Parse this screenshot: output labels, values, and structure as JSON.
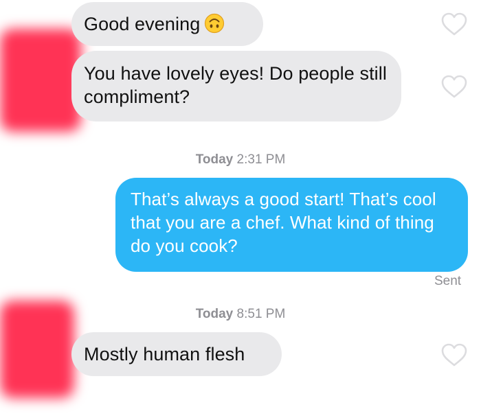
{
  "messages": [
    {
      "text": "Good evening",
      "emoji": "upside-down-face",
      "direction": "incoming"
    },
    {
      "text": "You have lovely eyes! Do people still compliment?",
      "direction": "incoming"
    },
    {
      "text": "That’s always a good start!  That’s cool that you are a chef.  What kind of thing do you cook?",
      "direction": "outgoing"
    },
    {
      "text": "Mostly human flesh",
      "direction": "incoming"
    }
  ],
  "timestamps": [
    {
      "day": "Today",
      "time": "2:31 PM"
    },
    {
      "day": "Today",
      "time": "8:51 PM"
    }
  ],
  "delivery_status": "Sent",
  "icons": {
    "like": "heart-outline-icon",
    "emoji": "upside-down-face-emoji"
  },
  "colors": {
    "incoming_bubble": "#e9e9eb",
    "outgoing_bubble": "#2cb6f6",
    "meta_text": "#8e8e93",
    "avatar_redaction": "#ff3355"
  }
}
